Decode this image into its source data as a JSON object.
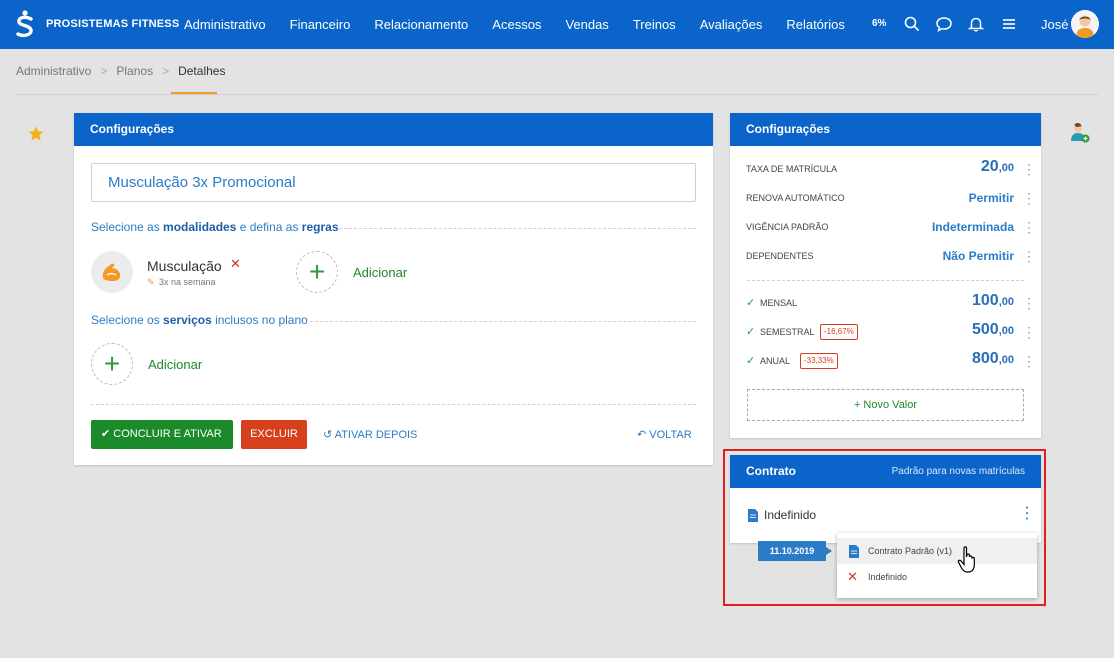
{
  "app": {
    "brand": "PROSISTEMAS FITNESS",
    "nav": [
      "Administrativo",
      "Financeiro",
      "Relacionamento",
      "Acessos",
      "Vendas",
      "Treinos",
      "Avaliações",
      "Relatórios"
    ],
    "progress_label": "6%",
    "user_name": "José"
  },
  "breadcrumb": {
    "items": [
      "Administrativo",
      "Planos",
      "Detalhes"
    ],
    "separator": ">"
  },
  "left_panel": {
    "title": "Configurações",
    "plan_name": "Musculação 3x Promocional",
    "modalities_label_pre": "Selecione as ",
    "modalities_label_b1": "modalidades",
    "modalities_label_mid": " e defina as ",
    "modalities_label_b2": "regras",
    "modality": {
      "name": "Musculação",
      "remove": "✕",
      "rule": "3x na semana"
    },
    "add_label": "Adicionar",
    "services_label_pre": "Selecione os ",
    "services_label_b": "serviços",
    "services_label_post": " inclusos no plano",
    "buttons": {
      "conclude": "CONCLUIR E ATIVAR",
      "delete": "EXCLUIR",
      "activate_later": "ATIVAR DEPOIS",
      "back": "VOLTAR"
    }
  },
  "right_panel": {
    "title": "Configurações",
    "rows": [
      {
        "label": "TAXA DE MATRÍCULA",
        "value": "20",
        "cents": ",00"
      },
      {
        "label": "RENOVA AUTOMÁTICO",
        "value": "Permitir"
      },
      {
        "label": "VIGÊNCIA PADRÃO",
        "value": "Indeterminada"
      },
      {
        "label": "DEPENDENTES",
        "value": "Não Permitir"
      }
    ],
    "prices": [
      {
        "label": "MENSAL",
        "value": "100",
        "cents": ",00",
        "discount": ""
      },
      {
        "label": "SEMESTRAL",
        "value": "500",
        "cents": ",00",
        "discount": "-16,67%"
      },
      {
        "label": "ANUAL",
        "value": "800",
        "cents": ",00",
        "discount": "-33,33%"
      }
    ],
    "new_value": "+ Novo Valor"
  },
  "contract_panel": {
    "title": "Contrato",
    "subtitle": "Padrão para novas matrículas",
    "current": "Indefinido",
    "date": "11.10.2019",
    "menu": [
      {
        "label": "Contrato Padrão (v1)",
        "icon": "document-icon"
      },
      {
        "label": "Indefinido",
        "icon": "close-icon"
      }
    ]
  },
  "colors": {
    "primary": "#0a64c9",
    "accent": "#f29a22",
    "success": "#1a8a2b",
    "danger": "#d6401c"
  }
}
